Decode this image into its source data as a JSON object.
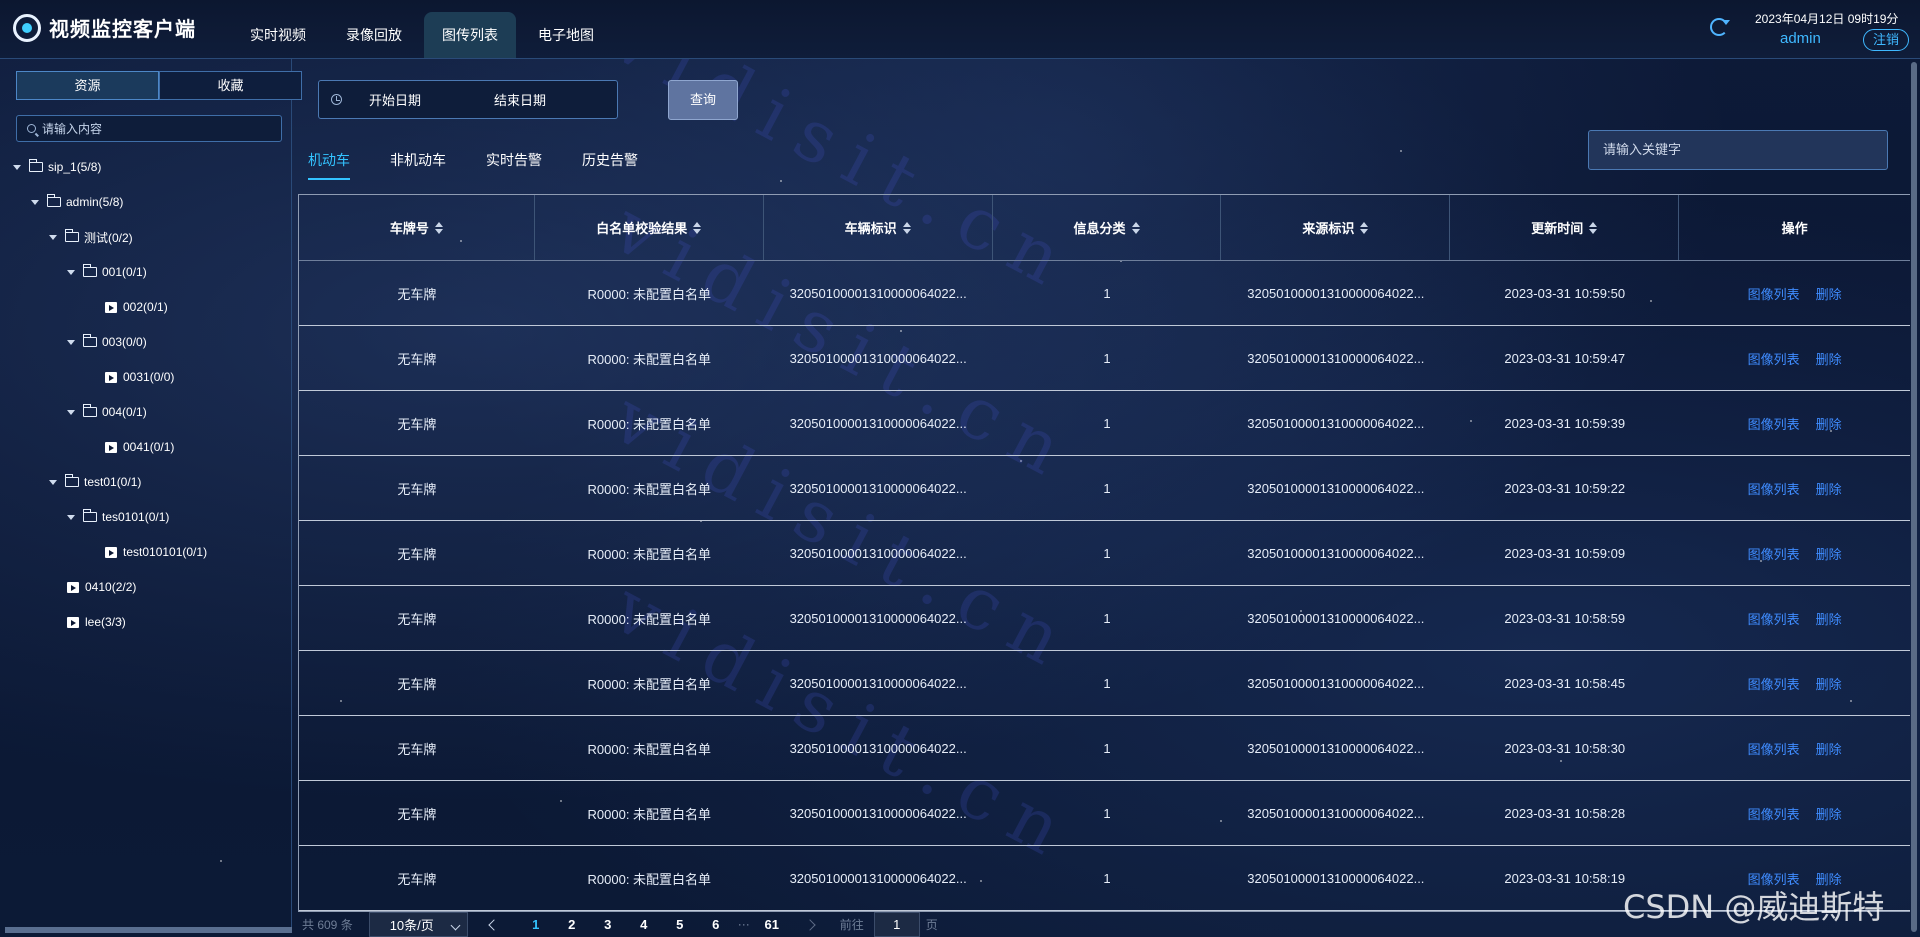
{
  "app": {
    "title": "视频监控客户端"
  },
  "nav": [
    {
      "label": "实时视频",
      "active": false
    },
    {
      "label": "录像回放",
      "active": false
    },
    {
      "label": "图传列表",
      "active": true
    },
    {
      "label": "电子地图",
      "active": false
    }
  ],
  "header": {
    "datetime": "2023年04月12日 09时19分",
    "user": "admin",
    "logout_label": "注销"
  },
  "sidebar": {
    "tabs": [
      {
        "label": "资源",
        "active": true
      },
      {
        "label": "收藏",
        "active": false
      }
    ],
    "search_placeholder": "请输入内容",
    "tree": [
      {
        "label": "sip_1(5/8)",
        "type": "folder",
        "expanded": true
      },
      {
        "label": "admin(5/8)",
        "type": "folder",
        "expanded": true
      },
      {
        "label": "测试(0/2)",
        "type": "folder",
        "expanded": true
      },
      {
        "label": "001(0/1)",
        "type": "folder",
        "expanded": true
      },
      {
        "label": "002(0/1)",
        "type": "camera"
      },
      {
        "label": "003(0/0)",
        "type": "folder",
        "expanded": true
      },
      {
        "label": "0031(0/0)",
        "type": "camera"
      },
      {
        "label": "004(0/1)",
        "type": "folder",
        "expanded": true
      },
      {
        "label": "0041(0/1)",
        "type": "camera"
      },
      {
        "label": "test01(0/1)",
        "type": "folder",
        "expanded": true
      },
      {
        "label": "tes0101(0/1)",
        "type": "folder",
        "expanded": true
      },
      {
        "label": "test010101(0/1)",
        "type": "camera"
      },
      {
        "label": "0410(2/2)",
        "type": "camera"
      },
      {
        "label": "lee(3/3)",
        "type": "camera"
      }
    ]
  },
  "filter": {
    "start_date": "开始日期",
    "end_date": "结束日期",
    "query_label": "查询",
    "keyword_placeholder": "请输入关键字"
  },
  "tabs": [
    {
      "label": "机动车",
      "active": true
    },
    {
      "label": "非机动车",
      "active": false
    },
    {
      "label": "实时告警",
      "active": false
    },
    {
      "label": "历史告警",
      "active": false
    }
  ],
  "table": {
    "columns": [
      "车牌号",
      "白名单校验结果",
      "车辆标识",
      "信息分类",
      "来源标识",
      "更新时间",
      "操作"
    ],
    "ops": [
      "图像列表",
      "删除"
    ],
    "rows": [
      [
        "无车牌",
        "R0000: 未配置白名单",
        "32050100001310000064022...",
        "1",
        "32050100001310000064022...",
        "2023-03-31 10:59:50"
      ],
      [
        "无车牌",
        "R0000: 未配置白名单",
        "32050100001310000064022...",
        "1",
        "32050100001310000064022...",
        "2023-03-31 10:59:47"
      ],
      [
        "无车牌",
        "R0000: 未配置白名单",
        "32050100001310000064022...",
        "1",
        "32050100001310000064022...",
        "2023-03-31 10:59:39"
      ],
      [
        "无车牌",
        "R0000: 未配置白名单",
        "32050100001310000064022...",
        "1",
        "32050100001310000064022...",
        "2023-03-31 10:59:22"
      ],
      [
        "无车牌",
        "R0000: 未配置白名单",
        "32050100001310000064022...",
        "1",
        "32050100001310000064022...",
        "2023-03-31 10:59:09"
      ],
      [
        "无车牌",
        "R0000: 未配置白名单",
        "32050100001310000064022...",
        "1",
        "32050100001310000064022...",
        "2023-03-31 10:58:59"
      ],
      [
        "无车牌",
        "R0000: 未配置白名单",
        "32050100001310000064022...",
        "1",
        "32050100001310000064022...",
        "2023-03-31 10:58:45"
      ],
      [
        "无车牌",
        "R0000: 未配置白名单",
        "32050100001310000064022...",
        "1",
        "32050100001310000064022...",
        "2023-03-31 10:58:30"
      ],
      [
        "无车牌",
        "R0000: 未配置白名单",
        "32050100001310000064022...",
        "1",
        "32050100001310000064022...",
        "2023-03-31 10:58:28"
      ],
      [
        "无车牌",
        "R0000: 未配置白名单",
        "32050100001310000064022...",
        "1",
        "32050100001310000064022...",
        "2023-03-31 10:58:19"
      ]
    ]
  },
  "pagination": {
    "total": "共 609 条",
    "page_size": "10条/页",
    "pages": [
      "1",
      "2",
      "3",
      "4",
      "5",
      "6"
    ],
    "ellipsis": "···",
    "last_page": "61",
    "current": "1",
    "goto_label": "前往",
    "goto_value": "1",
    "page_suffix": "页"
  },
  "watermark": {
    "text": "CSDN @威迪斯特",
    "background_text": "vidisit.cn"
  },
  "colors": {
    "accent": "#33c3ff",
    "link": "#3f8cff",
    "background": "#0b1733"
  }
}
